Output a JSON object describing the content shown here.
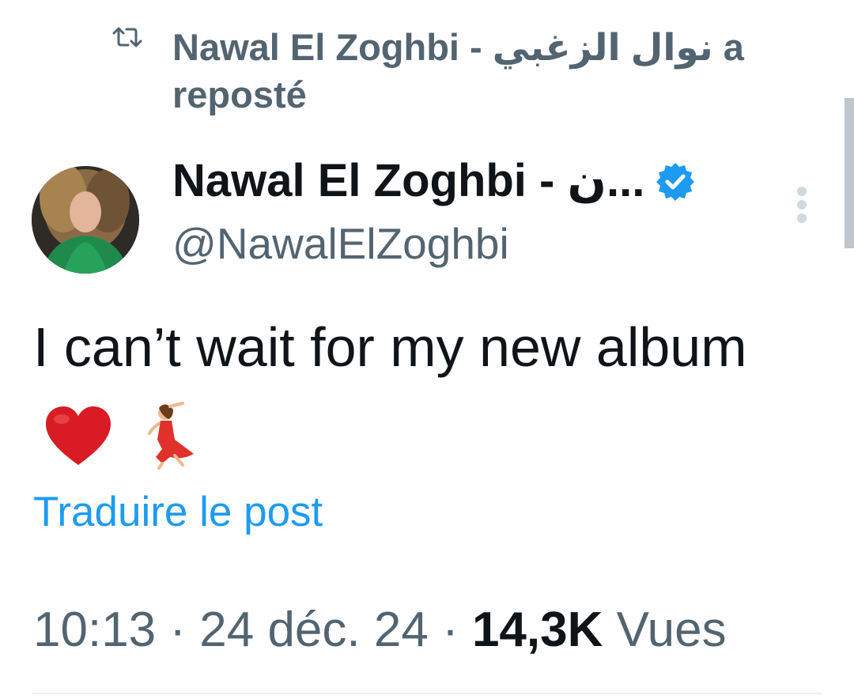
{
  "repost": {
    "icon": "repost-icon",
    "text": "Nawal El Zoghbi - نوال الزغبي a reposté"
  },
  "author": {
    "display_name": "Nawal El Zoghbi - ن...",
    "handle": "@NawalElZoghbi",
    "verified_icon": "verified-badge-icon",
    "badge_color": "#1d9bf0"
  },
  "tweet": {
    "text": "I can’t wait for my new album",
    "emojis": [
      "red-heart-emoji",
      "dancer-emoji"
    ]
  },
  "translate": {
    "label": "Traduire le post",
    "color": "#1d9bf0"
  },
  "meta": {
    "time": "10:13",
    "separator1": " · ",
    "date": "24 déc. 24",
    "separator2": " · ",
    "views_count": "14,3K",
    "views_label": " Vues"
  },
  "menu": {
    "icon": "more-options-icon"
  }
}
